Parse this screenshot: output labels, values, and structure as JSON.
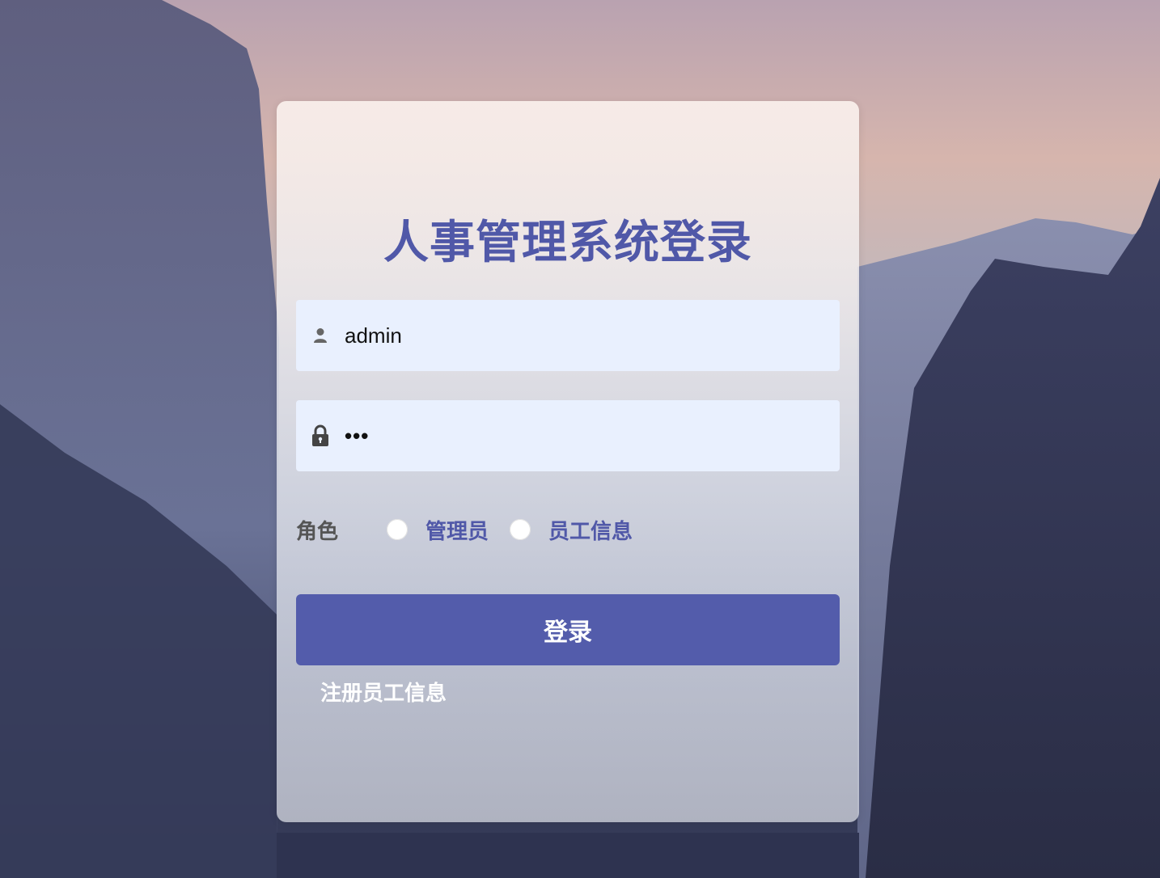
{
  "login": {
    "title": "人事管理系统登录",
    "username_value": "admin",
    "password_masked": "•••",
    "role_label": "角色",
    "roles": [
      {
        "label": "管理员"
      },
      {
        "label": "员工信息"
      }
    ],
    "submit_label": "登录",
    "register_link": "注册员工信息"
  },
  "icons": {
    "username": "user-icon",
    "password": "lock-icon"
  },
  "colors": {
    "accent": "#535cab",
    "title": "#5058a8",
    "field_bg": "#e9f0fe"
  }
}
